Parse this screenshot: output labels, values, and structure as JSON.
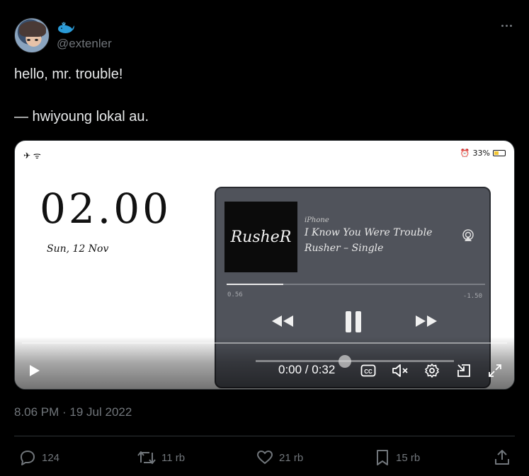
{
  "author": {
    "handle": "@extenler",
    "badge_icon": "whale-icon"
  },
  "tweet": {
    "line1": "hello, mr. trouble!",
    "line2": "— hwiyoung lokal au."
  },
  "video": {
    "status": {
      "left": "✈ ᯤ",
      "battery": "33%"
    },
    "clock": "02.00",
    "date": "Sun, 12 Nov",
    "player": {
      "cover_text": "RusheR",
      "device": "iPhone",
      "song": "I Know You Were Trouble",
      "artist": "Rusher – Single",
      "elapsed": "0.56",
      "remaining": "-1.50",
      "progress": 0.22
    },
    "controls": {
      "time": "0:00 / 0:32",
      "cc_label": "CC"
    }
  },
  "timestamp": "8.06 PM · 19 Jul 2022",
  "actions": {
    "replies": "124",
    "retweets": "11 rb",
    "likes": "21 rb",
    "bookmarks": "15 rb"
  },
  "colors": {
    "muted": "#71767b",
    "text": "#e7e9ea",
    "background": "#000000"
  }
}
